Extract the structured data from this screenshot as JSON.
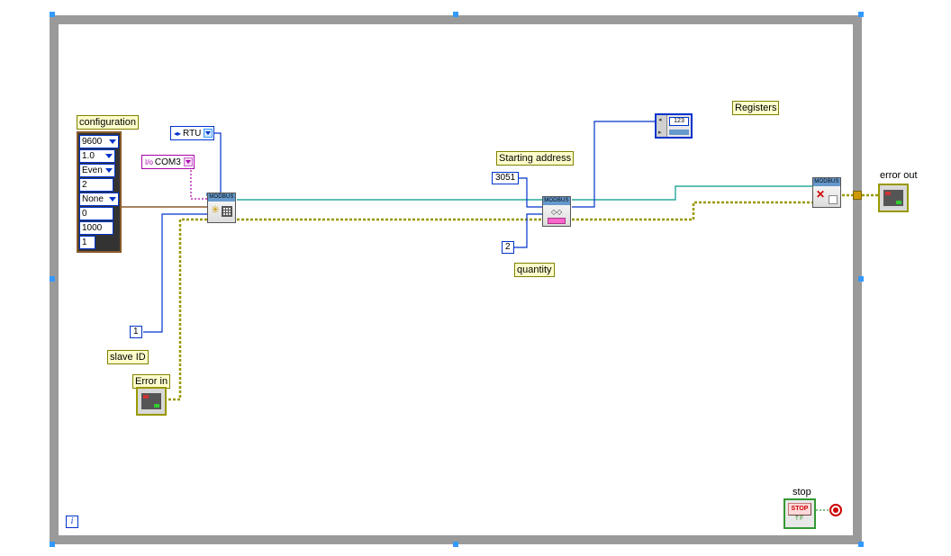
{
  "labels": {
    "configuration": "configuration",
    "slave_id": "slave ID",
    "error_in": "Error in",
    "starting_address": "Starting address",
    "quantity": "quantity",
    "registers": "Registers",
    "error_out": "error out",
    "stop": "stop"
  },
  "config_cluster": {
    "baud": "9600",
    "stop_bits": "1.0",
    "parity": "Even",
    "data_bits": "2",
    "flow": "None",
    "timeout_a": "0",
    "timeout_b": "1000",
    "retry": "1"
  },
  "constants": {
    "mode": "RTU",
    "visa_resource": "COM3",
    "slave_id": "1",
    "starting_address": "3051",
    "quantity": "2",
    "iter_sym": "i",
    "array_num": "123"
  },
  "nodes": {
    "modbus_title": "MODBUS",
    "stop_text": "STOP",
    "tf_text": "TF"
  },
  "chart_data": {
    "type": "block-diagram",
    "tool": "LabVIEW",
    "structure": "while-loop",
    "nodes": [
      {
        "id": "config",
        "type": "cluster-constant",
        "fields": [
          "baud",
          "stop_bits",
          "parity",
          "data_bits",
          "flow",
          "timeout_a",
          "timeout_b",
          "retry"
        ]
      },
      {
        "id": "mode",
        "type": "enum-constant",
        "value": "RTU"
      },
      {
        "id": "visa",
        "type": "visa-resource-constant",
        "value": "COM3"
      },
      {
        "id": "slave",
        "type": "numeric-constant",
        "value": 1
      },
      {
        "id": "error_in",
        "type": "error-cluster-control"
      },
      {
        "id": "modbus_init",
        "type": "subvi",
        "label": "MODBUS Init"
      },
      {
        "id": "start_addr",
        "type": "numeric-constant",
        "value": 3051
      },
      {
        "id": "qty",
        "type": "numeric-constant",
        "value": 2
      },
      {
        "id": "modbus_read",
        "type": "subvi",
        "label": "MODBUS Read"
      },
      {
        "id": "registers",
        "type": "array-indicator"
      },
      {
        "id": "modbus_close",
        "type": "subvi",
        "label": "MODBUS Close"
      },
      {
        "id": "error_out",
        "type": "error-cluster-indicator"
      },
      {
        "id": "stop",
        "type": "boolean-control"
      },
      {
        "id": "loop_cond",
        "type": "loop-condition"
      },
      {
        "id": "iter",
        "type": "iteration-terminal"
      }
    ],
    "wires": [
      {
        "from": "config",
        "to": "modbus_init",
        "type": "cluster"
      },
      {
        "from": "mode",
        "to": "modbus_init",
        "type": "enum"
      },
      {
        "from": "visa",
        "to": "modbus_init",
        "type": "string"
      },
      {
        "from": "slave",
        "to": "modbus_init",
        "type": "numeric"
      },
      {
        "from": "error_in",
        "to": "modbus_init",
        "type": "error"
      },
      {
        "from": "modbus_init",
        "to": "modbus_read",
        "type": "refnum"
      },
      {
        "from": "modbus_init",
        "to": "modbus_read",
        "type": "error"
      },
      {
        "from": "start_addr",
        "to": "modbus_read",
        "type": "numeric"
      },
      {
        "from": "qty",
        "to": "modbus_read",
        "type": "numeric"
      },
      {
        "from": "modbus_read",
        "to": "registers",
        "type": "array"
      },
      {
        "from": "modbus_read",
        "to": "modbus_close",
        "type": "refnum"
      },
      {
        "from": "modbus_read",
        "to": "modbus_close",
        "type": "error"
      },
      {
        "from": "modbus_close",
        "to": "error_out",
        "type": "error"
      },
      {
        "from": "stop",
        "to": "loop_cond",
        "type": "boolean"
      }
    ]
  }
}
